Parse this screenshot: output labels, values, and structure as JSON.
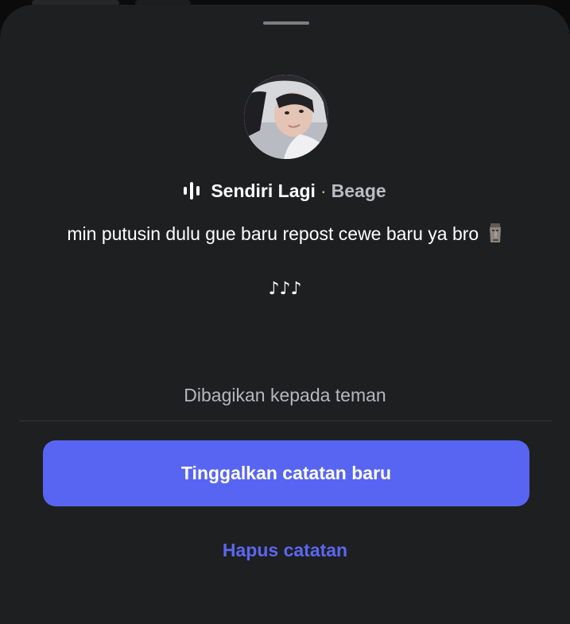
{
  "song": {
    "title": "Sendiri Lagi",
    "separator": "·",
    "artist": "Beage",
    "icon": "audio-wave-icon"
  },
  "note": {
    "text": "min putusin dulu gue baru repost cewe baru ya bro",
    "emoji_icon": "moai-icon",
    "music_notes": "♪♪♪"
  },
  "share": {
    "label": "Dibagikan kepada teman"
  },
  "actions": {
    "primary_label": "Tinggalkan catatan baru",
    "secondary_label": "Hapus catatan"
  },
  "colors": {
    "sheet_background": "#1e1f20",
    "primary_button": "#5865f2",
    "link": "#5a67f0",
    "muted_text": "#b4b7bd"
  }
}
